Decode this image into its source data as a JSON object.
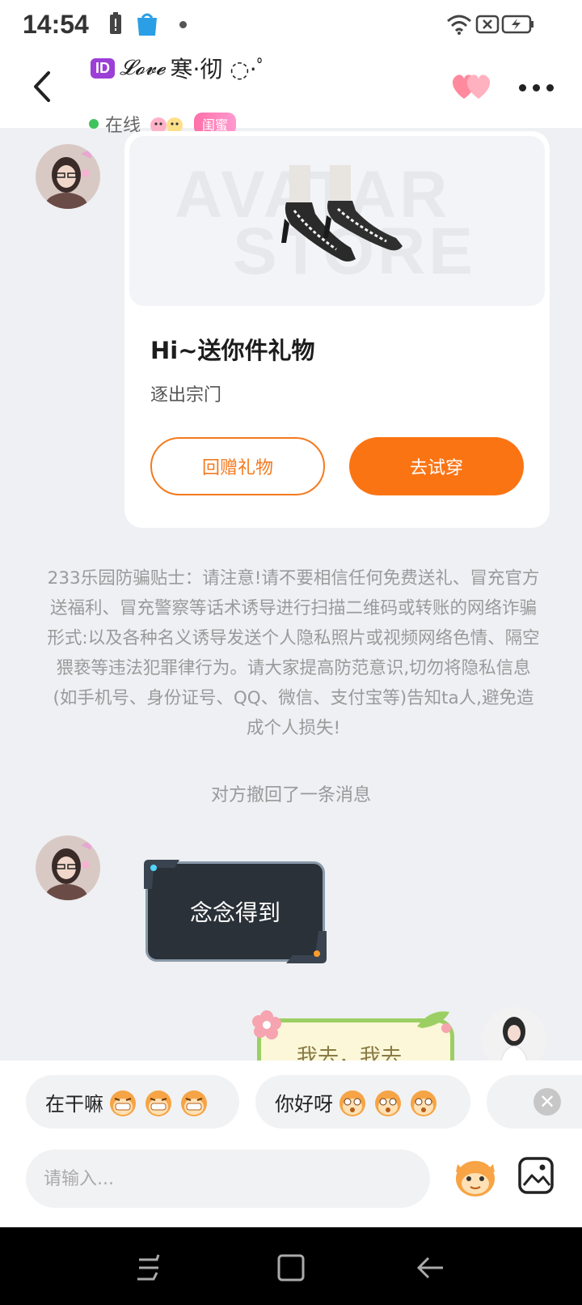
{
  "status_bar": {
    "time": "14:54"
  },
  "header": {
    "id_badge": "ID",
    "title_script": "𝓛𝓸𝓿𝓮",
    "title_rest": "寒·彻 ◌·ﾟ",
    "online_text": "在线",
    "tag_text": "闺蜜"
  },
  "gift_card": {
    "watermark_top": "AVATAR",
    "watermark_bottom": "STORE",
    "title": "Hi~送你件礼物",
    "subtitle": "逐出宗门",
    "return_gift_label": "回赠礼物",
    "try_on_label": "去试穿"
  },
  "warning_text": "233乐园防骗贴士：请注意!请不要相信任何免费送礼、冒充官方送福利、冒充警察等话术诱导进行扫描二维码或转账的网络诈骗形式:以及各种名义诱导发送个人隐私照片或视频网络色情、隔空猥亵等违法犯罪律行为。请大家提高防范意识,切勿将隐私信息(如手机号、身份证号、QQ、微信、支付宝等)告知ta人,避免造成个人损失!",
  "recall_notice": "对方撤回了一条消息",
  "messages": {
    "dark_bubble_text": "念念得到",
    "green_bubble_text": "我去，我去"
  },
  "quick_replies": [
    {
      "label": "在干嘛"
    },
    {
      "label": "你好呀"
    }
  ],
  "input": {
    "placeholder": "请输入..."
  },
  "colors": {
    "accent": "#fb7414",
    "online": "#3fc35f"
  }
}
